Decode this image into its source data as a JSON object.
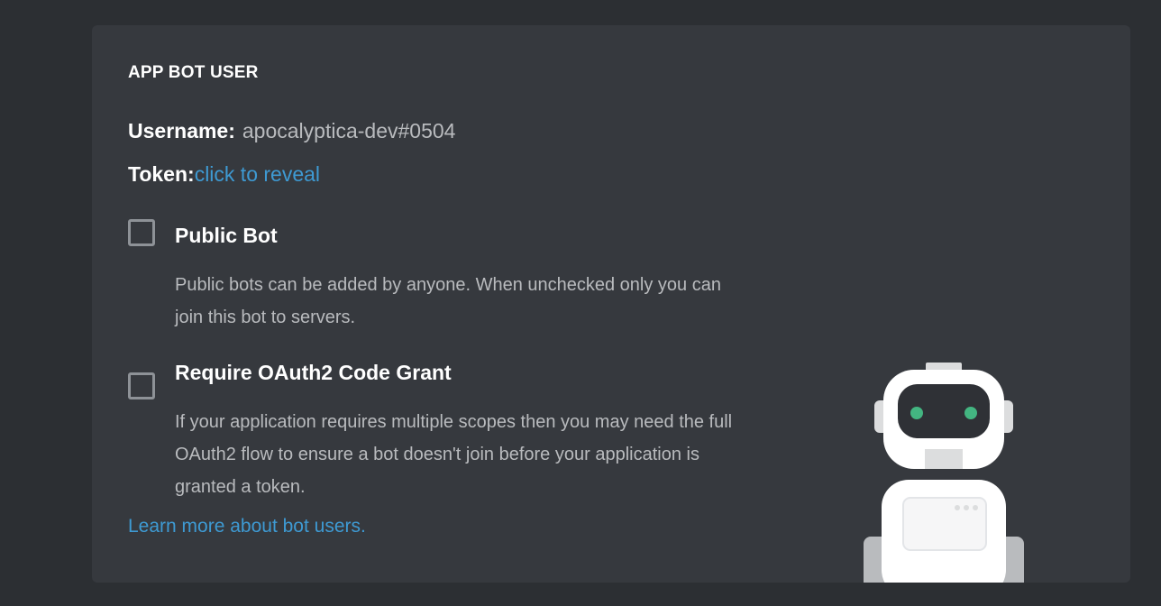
{
  "bot_user": {
    "section_title": "APP BOT USER",
    "username_label": "Username:",
    "username_value": "apocalyptica-dev#0504",
    "token_label": "Token:",
    "token_link": "click to reveal"
  },
  "options": {
    "public_bot": {
      "title": "Public Bot",
      "checked": false,
      "description": "Public bots can be added by anyone. When unchecked only you can join this bot to servers."
    },
    "oauth_grant": {
      "title": "Require OAuth2 Code Grant",
      "checked": false,
      "description": "If your application requires multiple scopes then you may need the full OAuth2 flow to ensure a bot doesn't join before your application is granted a token."
    }
  },
  "footer": {
    "learn_more_link": "Learn more about bot users."
  },
  "colors": {
    "page_background": "#2c2f33",
    "card_background": "#36393e",
    "link": "#3e9ad3",
    "muted_text": "#b9bbbe",
    "robot_eyes": "#43b581"
  },
  "illustration": {
    "icon": "robot-illustration"
  }
}
